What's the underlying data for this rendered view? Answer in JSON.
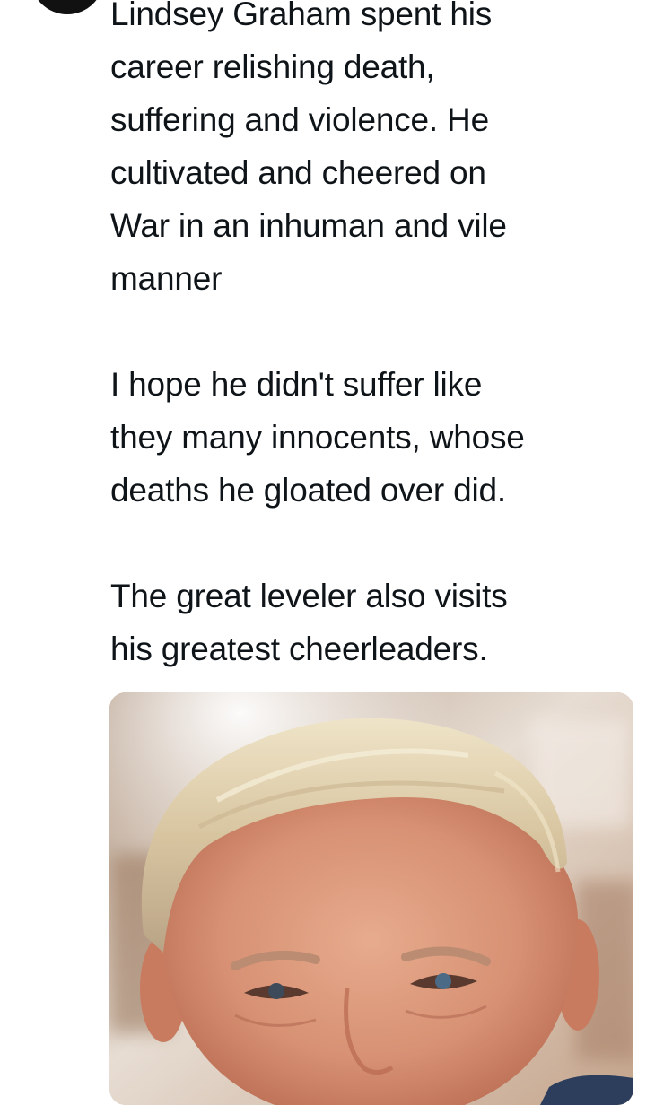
{
  "tweet": {
    "author_avatar_icon": "user-avatar",
    "paragraphs": [
      "Lindsey Graham spent his\ncareer relishing death,\nsuffering and violence. He\ncultivated and cheered on\nWar in an inhuman and vile\nmanner",
      "I hope he didn't suffer like\nthey many innocents, whose\ndeaths he gloated over did.",
      "The great leveler also visits\nhis greatest cheerleaders."
    ],
    "media": {
      "type": "photo",
      "subject_icon": "portrait-photo"
    }
  },
  "colors": {
    "text": "#0f1419",
    "background": "#ffffff",
    "avatar": "#111111"
  }
}
